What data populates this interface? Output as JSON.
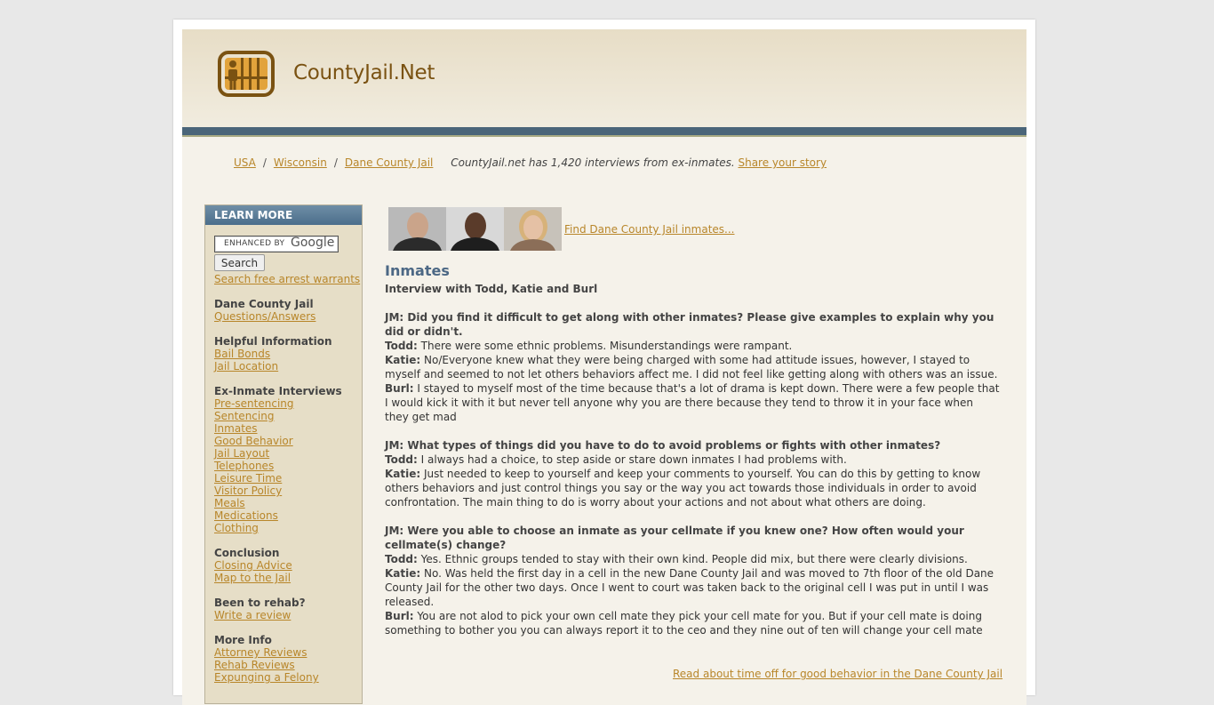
{
  "site": {
    "title": "CountyJail.Net"
  },
  "breadcrumb": {
    "items": [
      "USA",
      "Wisconsin",
      "Dane County Jail"
    ],
    "note": "CountyJail.net has 1,420 interviews from ex-inmates.",
    "share_link": "Share your story"
  },
  "sidebar": {
    "heading": "LEARN MORE",
    "search_placeholder": "ENHANCED BY",
    "search_brand": "Google",
    "search_button": "Search",
    "warrants_link": "Search free arrest warrants",
    "groups": [
      {
        "heading": "Dane County Jail",
        "links": [
          "Questions/Answers"
        ]
      },
      {
        "heading": "Helpful Information",
        "links": [
          "Bail Bonds",
          "Jail Location"
        ]
      },
      {
        "heading": "Ex-Inmate Interviews",
        "links": [
          "Pre-sentencing",
          "Sentencing",
          "Inmates",
          "Good Behavior",
          "Jail Layout",
          "Telephones",
          "Leisure Time",
          "Visitor Policy",
          "Meals",
          "Medications",
          "Clothing"
        ]
      },
      {
        "heading": "Conclusion",
        "links": [
          "Closing Advice",
          "Map to the Jail"
        ]
      },
      {
        "heading": "Been to rehab?",
        "links": [
          "Write a review"
        ]
      },
      {
        "heading": "More Info",
        "links": [
          "Attorney Reviews",
          "Rehab Reviews",
          "Expunging a Felony"
        ]
      }
    ]
  },
  "find_link": "Find Dane County Jail inmates...",
  "content": {
    "title": "Inmates",
    "subtitle": "Interview with Todd, Katie and Burl",
    "qa": [
      {
        "q": "JM: Did you find it difficult to get along with other inmates? Please give examples to explain why you did or didn't.",
        "answers": [
          {
            "who": "Todd:",
            "text": "There were some ethnic problems. Misunderstandings were rampant."
          },
          {
            "who": "Katie:",
            "text": "No/Everyone knew what they were being charged with some had attitude issues, however, I stayed to myself and seemed to not let others behaviors affect me. I did not feel like getting along with others was an issue."
          },
          {
            "who": "Burl:",
            "text": "I stayed to myself most of the time because that's a lot of drama is kept down. There were a few people that I would kick it with it but never tell anyone why you are there because they tend to throw it in your face when they get mad"
          }
        ]
      },
      {
        "q": "JM: What types of things did you have to do to avoid problems or fights with other inmates?",
        "answers": [
          {
            "who": "Todd:",
            "text": "I always had a choice, to step aside or stare down inmates I had problems with."
          },
          {
            "who": "Katie:",
            "text": "Just needed to keep to yourself and keep your comments to yourself. You can do this by getting to know others behaviors and just control things you say or the way you act towards those individuals in order to avoid confrontation. The main thing to do is worry about your actions and not about what others are doing."
          }
        ]
      },
      {
        "q": "JM: Were you able to choose an inmate as your cellmate if you knew one? How often would your cellmate(s) change?",
        "answers": [
          {
            "who": "Todd:",
            "text": "Yes. Ethnic groups tended to stay with their own kind. People did mix, but there were clearly divisions."
          },
          {
            "who": "Katie:",
            "text": "No. Was held the first day in a cell in the new Dane County Jail and was moved to 7th floor of the old Dane County Jail for the other two days. Once I went to court was taken back to the original cell I was put in until I was released."
          },
          {
            "who": "Burl:",
            "text": "You are not alod to pick your own cell mate they pick your cell mate for you. But if your cell mate is doing something to bother you you can always report it to the ceo and they nine out of ten will change your cell mate"
          }
        ]
      }
    ],
    "next_link": "Read about time off for good behavior in the Dane County Jail"
  }
}
